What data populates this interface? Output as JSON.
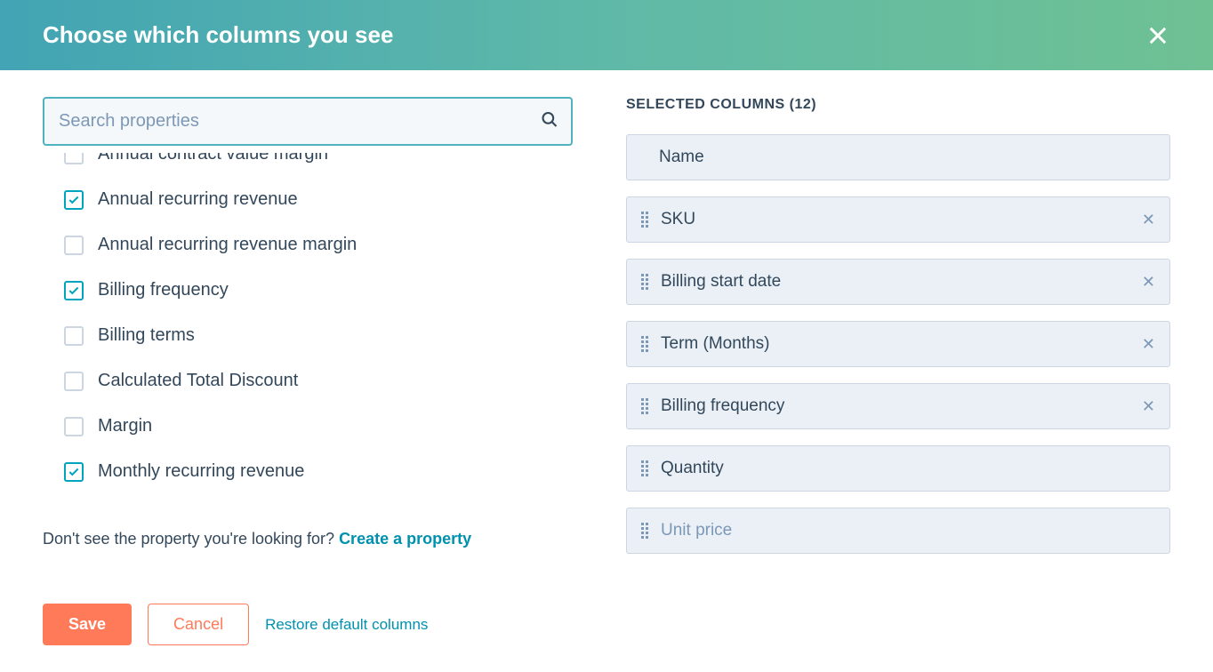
{
  "header": {
    "title": "Choose which columns you see"
  },
  "search": {
    "placeholder": "Search properties"
  },
  "properties": [
    {
      "label": "Annual contract value margin",
      "checked": false
    },
    {
      "label": "Annual recurring revenue",
      "checked": true
    },
    {
      "label": "Annual recurring revenue margin",
      "checked": false
    },
    {
      "label": "Billing frequency",
      "checked": true
    },
    {
      "label": "Billing terms",
      "checked": false
    },
    {
      "label": "Calculated Total Discount",
      "checked": false
    },
    {
      "label": "Margin",
      "checked": false
    },
    {
      "label": "Monthly recurring revenue",
      "checked": true
    }
  ],
  "helper": {
    "text": "Don't see the property you're looking for? ",
    "link": "Create a property"
  },
  "footer": {
    "save": "Save",
    "cancel": "Cancel",
    "restore": "Restore default columns"
  },
  "selected": {
    "heading_prefix": "SELECTED COLUMNS",
    "count": 12,
    "items": [
      {
        "label": "Name",
        "locked": true
      },
      {
        "label": "SKU",
        "locked": false
      },
      {
        "label": "Billing start date",
        "locked": false
      },
      {
        "label": "Term (Months)",
        "locked": false
      },
      {
        "label": "Billing frequency",
        "locked": false
      },
      {
        "label": "Quantity",
        "locked": false
      },
      {
        "label": "Unit price",
        "locked": false
      }
    ]
  }
}
